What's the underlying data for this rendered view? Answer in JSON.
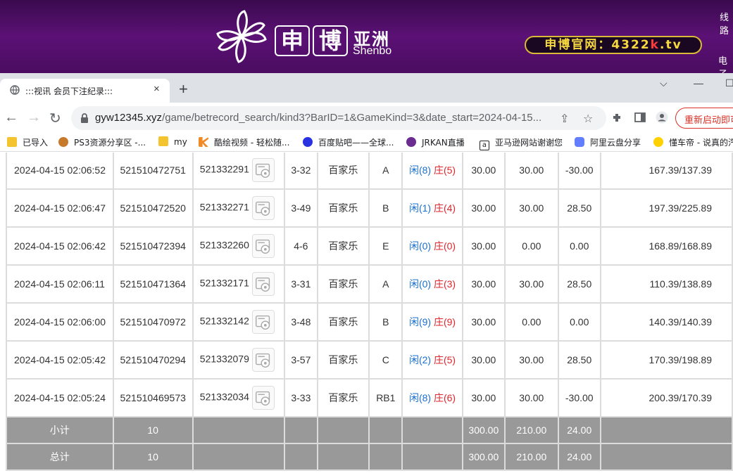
{
  "banner": {
    "logo_char1": "申",
    "logo_char2": "博",
    "logo_cn": "亚洲",
    "logo_en": "Shenbo",
    "site_prefix": "申博官网：4322",
    "site_k": "k",
    "site_suffix": ".tv",
    "edge_top": "线路",
    "edge_bottom": "电子"
  },
  "browser": {
    "tab_title": ":::视讯 会员下注纪录:::",
    "tab_close": "×",
    "new_tab": "+",
    "url_host": "gyw12345.xyz",
    "url_path": "/game/betrecord_search/kind3?BarID=1&GameKind=3&date_start=2024-04-15...",
    "restart_label": "重新启动即可"
  },
  "bookmarks": [
    {
      "label": "已导入",
      "icon": "folder-icon",
      "color": "#f4c430"
    },
    {
      "label": "PS3资源分享区 -...",
      "icon": "raccoon-icon",
      "color": "#c77b2a"
    },
    {
      "label": "my",
      "icon": "folder-icon",
      "color": "#f4c430"
    },
    {
      "label": "酷绘视频 - 轻松随...",
      "icon": "k-logo-icon",
      "color": "#f08a24"
    },
    {
      "label": "百度贴吧——全球...",
      "icon": "baidu-paw-icon",
      "color": "#2932e1"
    },
    {
      "label": "JRKAN直播",
      "icon": "jrkan-icon",
      "color": "#6a2c91"
    },
    {
      "label": "亚马逊网站谢谢您",
      "icon": "amazon-icon",
      "color": "#222222"
    },
    {
      "label": "阿里云盘分享",
      "icon": "aliyun-icon",
      "color": "#637dff"
    },
    {
      "label": "懂车帝 - 说真的汽",
      "icon": "dongchedi-icon",
      "color": "#ffd100"
    }
  ],
  "records": [
    {
      "time": "2024-04-15 02:06:52",
      "order": "521510472751",
      "round": "521332291",
      "table": "3-32",
      "game": "百家乐",
      "bet": "A",
      "xian": "闲(8)",
      "zhuang": "庄(5)",
      "amount": "30.00",
      "valid": "30.00",
      "result": "-30.00",
      "neg": true,
      "balance": "167.39/137.39"
    },
    {
      "time": "2024-04-15 02:06:47",
      "order": "521510472520",
      "round": "521332271",
      "table": "3-49",
      "game": "百家乐",
      "bet": "B",
      "xian": "闲(1)",
      "zhuang": "庄(4)",
      "amount": "30.00",
      "valid": "30.00",
      "result": "28.50",
      "neg": false,
      "balance": "197.39/225.89"
    },
    {
      "time": "2024-04-15 02:06:42",
      "order": "521510472394",
      "round": "521332260",
      "table": "4-6",
      "game": "百家乐",
      "bet": "E",
      "xian": "闲(0)",
      "zhuang": "庄(0)",
      "amount": "30.00",
      "valid": "0.00",
      "result": "0.00",
      "neg": false,
      "balance": "168.89/168.89"
    },
    {
      "time": "2024-04-15 02:06:11",
      "order": "521510471364",
      "round": "521332171",
      "table": "3-31",
      "game": "百家乐",
      "bet": "A",
      "xian": "闲(0)",
      "zhuang": "庄(3)",
      "amount": "30.00",
      "valid": "30.00",
      "result": "28.50",
      "neg": false,
      "balance": "110.39/138.89"
    },
    {
      "time": "2024-04-15 02:06:00",
      "order": "521510470972",
      "round": "521332142",
      "table": "3-48",
      "game": "百家乐",
      "bet": "B",
      "xian": "闲(9)",
      "zhuang": "庄(9)",
      "amount": "30.00",
      "valid": "0.00",
      "result": "0.00",
      "neg": false,
      "balance": "140.39/140.39"
    },
    {
      "time": "2024-04-15 02:05:42",
      "order": "521510470294",
      "round": "521332079",
      "table": "3-57",
      "game": "百家乐",
      "bet": "C",
      "xian": "闲(2)",
      "zhuang": "庄(5)",
      "amount": "30.00",
      "valid": "30.00",
      "result": "28.50",
      "neg": false,
      "balance": "170.39/198.89"
    },
    {
      "time": "2024-04-15 02:05:24",
      "order": "521510469573",
      "round": "521332034",
      "table": "3-33",
      "game": "百家乐",
      "bet": "RB1",
      "xian": "闲(8)",
      "zhuang": "庄(6)",
      "amount": "30.00",
      "valid": "30.00",
      "result": "-30.00",
      "neg": true,
      "balance": "200.39/170.39"
    }
  ],
  "subtotal": {
    "label": "小计",
    "count": "10",
    "amount": "300.00",
    "valid": "210.00",
    "result": "24.00"
  },
  "total": {
    "label": "总计",
    "count": "10",
    "amount": "300.00",
    "valid": "210.00",
    "result": "24.00"
  },
  "colors": {
    "banner": "#4a0c60",
    "gold": "#f6d93f",
    "blue_text": "#1a6fd0",
    "red_text": "#e0242b",
    "sum_bg": "#999999"
  }
}
